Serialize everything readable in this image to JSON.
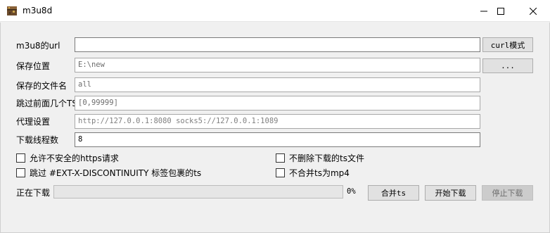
{
  "window": {
    "title": "m3u8d",
    "app_icon": "treasure-chest-icon",
    "controls": {
      "minimize": "minimize-icon",
      "maximize": "maximize-icon",
      "close": "close-icon"
    }
  },
  "form": {
    "url": {
      "label": "m3u8的url",
      "value": ""
    },
    "curl_button": "curl模式",
    "save_location": {
      "label": "保存位置",
      "value": "E:\\new"
    },
    "browse_button": "...",
    "filename": {
      "label": "保存的文件名",
      "value": "all"
    },
    "skip_ts": {
      "label": "跳过前面几个TS",
      "value": "[0,99999]"
    },
    "proxy": {
      "label": "代理设置",
      "placeholder": "http://127.0.0.1:8080 socks5://127.0.0.1:1089"
    },
    "threads": {
      "label": "下载线程数",
      "value": "8"
    }
  },
  "options": {
    "allow_insecure_https": {
      "label": "允许不安全的https请求",
      "checked": false
    },
    "keep_ts_files": {
      "label": "不删除下载的ts文件",
      "checked": false
    },
    "skip_discontinuity": {
      "label": "跳过 #EXT-X-DISCONTINUITY 标签包裹的ts",
      "checked": false
    },
    "no_merge_mp4": {
      "label": "不合并ts为mp4",
      "checked": false
    }
  },
  "status": {
    "label": "正在下载",
    "progress_percent": 0,
    "progress_text": "0%"
  },
  "actions": {
    "merge_ts": "合并ts",
    "start_download": "开始下载",
    "stop_download": "停止下载"
  }
}
